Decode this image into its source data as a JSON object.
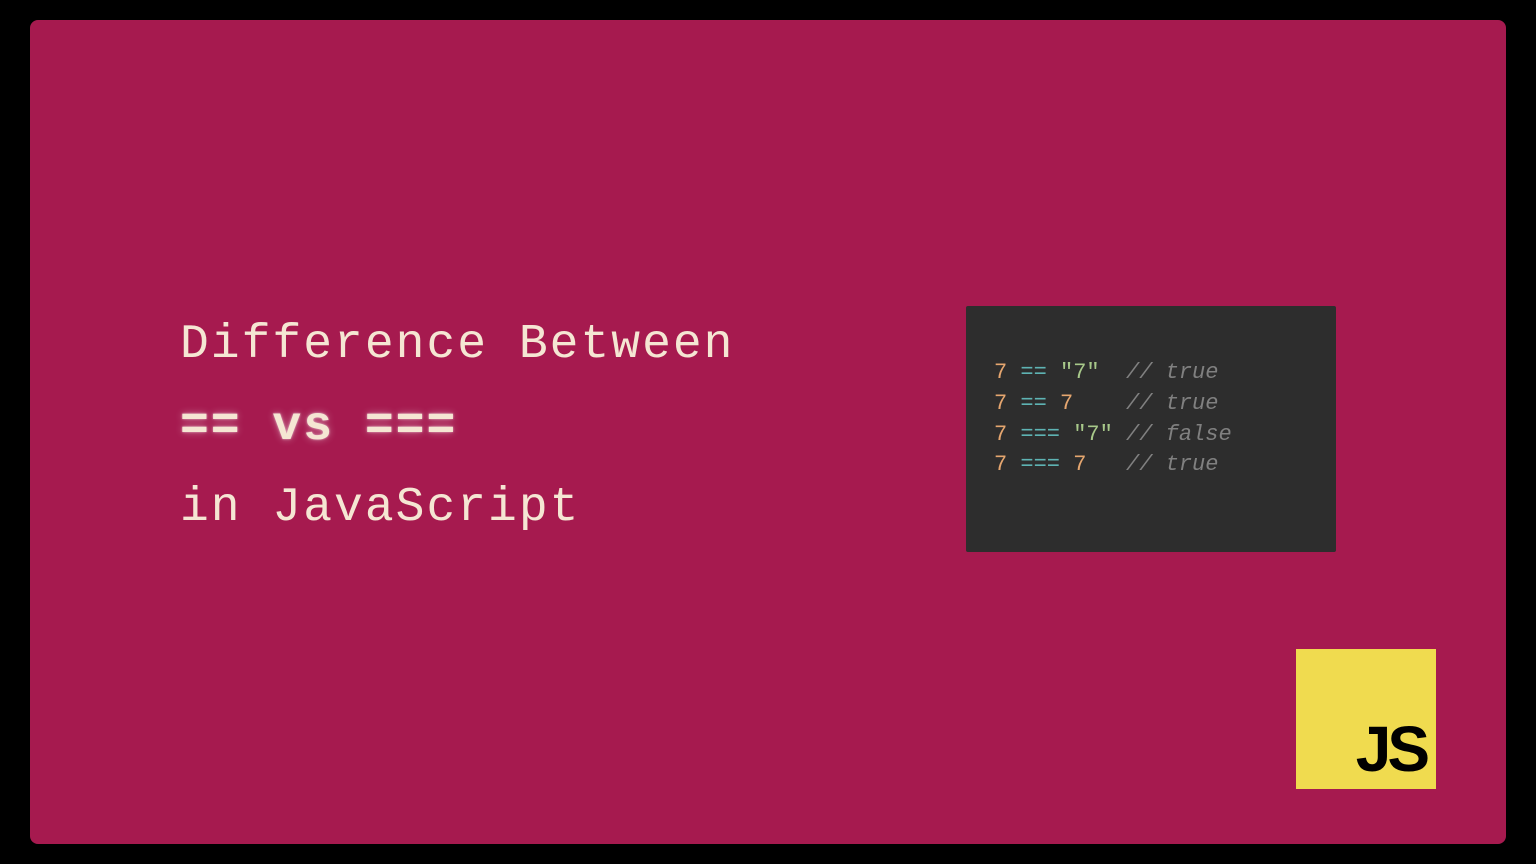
{
  "title": {
    "line1": "Difference Between",
    "line2": "== vs ===",
    "line3": "in JavaScript"
  },
  "code": {
    "lines": [
      {
        "left": "7",
        "op": "==",
        "right": "\"7\"",
        "rightType": "str",
        "comment": "// true"
      },
      {
        "left": "7",
        "op": "==",
        "right": "7",
        "rightType": "num",
        "comment": "// true"
      },
      {
        "left": "7",
        "op": "===",
        "right": "\"7\"",
        "rightType": "str",
        "comment": "// false"
      },
      {
        "left": "7",
        "op": "===",
        "right": "7",
        "rightType": "num",
        "comment": "// true"
      }
    ]
  },
  "logo": {
    "text": "JS"
  }
}
